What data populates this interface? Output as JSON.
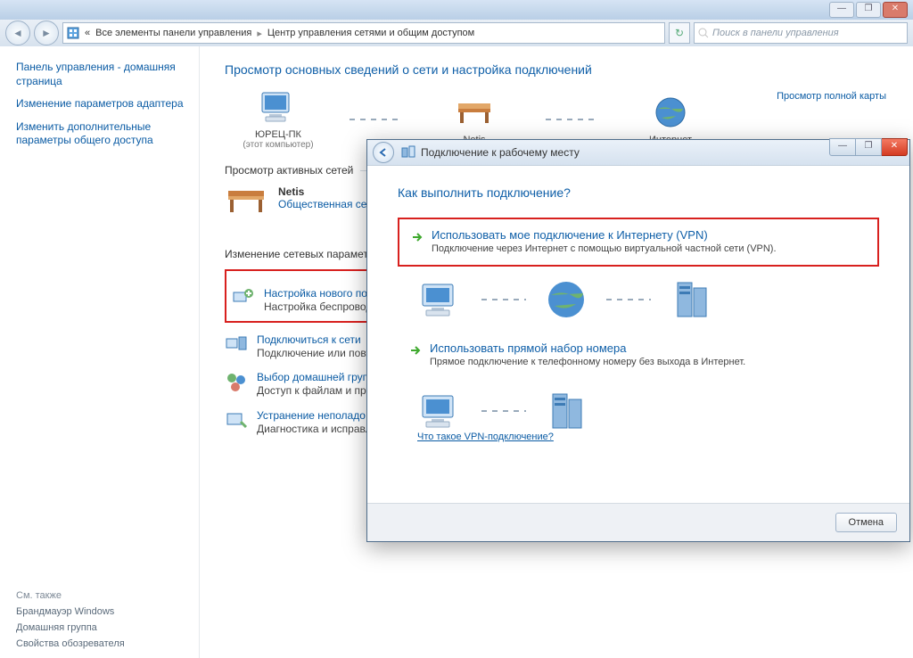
{
  "window_controls": {
    "min": "—",
    "max": "❐",
    "close": "✕"
  },
  "breadcrumb": {
    "back": "◄",
    "forward": "►",
    "home_icon": "⬚",
    "all": "Все элементы панели управления",
    "current": "Центр управления сетями и общим доступом"
  },
  "addr_refresh": "↻",
  "search": {
    "placeholder": "Поиск в панели управления"
  },
  "sidebar": {
    "home": "Панель управления - домашняя страница",
    "items": [
      "Изменение параметров адаптера",
      "Изменить дополнительные параметры общего доступа"
    ],
    "see_also": "См. также",
    "footer": [
      "Брандмауэр Windows",
      "Домашняя группа",
      "Свойства обозревателя"
    ]
  },
  "content": {
    "title": "Просмотр основных сведений о сети и настройка подключений",
    "map_link": "Просмотр полной карты",
    "nodes": {
      "pc": "ЮРЕЦ-ПК",
      "pc_sub": "(этот компьютер)",
      "router": "Netis",
      "internet": "Интернет"
    },
    "active_hdr": "Просмотр активных сетей",
    "active": {
      "name": "Netis",
      "status": "Общественная сеть"
    },
    "params_hdr": "Изменение сетевых параметров",
    "params": [
      {
        "title": "Настройка нового под",
        "desc": "Настройка беспроводн\nили же настройка мар"
      },
      {
        "title": "Подключиться к сети",
        "desc": "Подключение или повт\nсетевому соединению"
      },
      {
        "title": "Выбор домашней груп",
        "desc": "Доступ к файлам и при\nизменение параметро"
      },
      {
        "title": "Устранение неполадо",
        "desc": "Диагностика и исправл"
      }
    ]
  },
  "dialog": {
    "title": "Подключение к рабочему месту",
    "question": "Как выполнить подключение?",
    "opt1": {
      "title": "Использовать мое подключение к Интернету (VPN)",
      "desc": "Подключение через Интернет с помощью виртуальной частной сети (VPN)."
    },
    "opt2": {
      "title": "Использовать прямой набор номера",
      "desc": "Прямое подключение к телефонному номеру без выхода в Интернет."
    },
    "vpn_link": "Что такое VPN-подключение?",
    "cancel": "Отмена",
    "win": {
      "min": "—",
      "max": "❐",
      "close": "✕"
    }
  }
}
